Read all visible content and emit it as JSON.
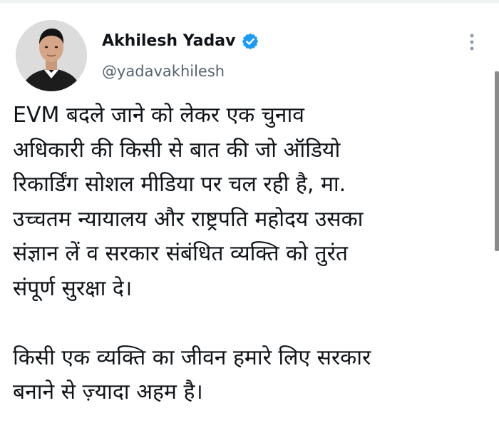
{
  "author": {
    "display_name": "Akhilesh Yadav",
    "handle": "@yadavakhilesh",
    "avatar_icon": "profile-photo-avatar",
    "verified_icon": "verified-badge-icon",
    "verified_color": "#1d9bf0"
  },
  "menu": {
    "icon": "more-options-icon"
  },
  "tweet": {
    "paragraph1": [
      "EVM बदले जाने को लेकर एक चुनाव",
      "अधिकारी की किसी से बात की जो ऑडियो",
      "रिकार्डिंग सोशल मीडिया पर चल रही है, मा.",
      "उच्चतम न्यायालय और राष्ट्रपति महोदय उसका",
      "संज्ञान लें व सरकार संबंधित व्यक्ति को तुरंत",
      "संपूर्ण सुरक्षा दे।"
    ],
    "paragraph2": [
      "किसी एक व्यक्ति का जीवन हमारे लिए सरकार",
      "बनाने से ज़्यादा अहम है।"
    ]
  }
}
